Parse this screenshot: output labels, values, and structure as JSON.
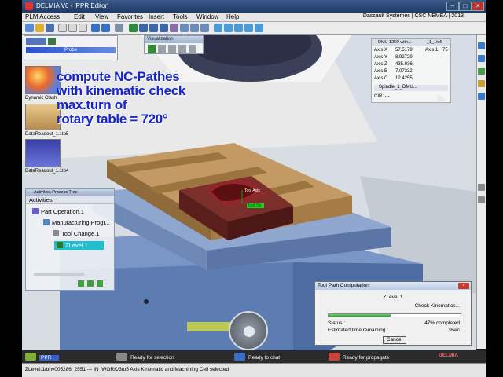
{
  "window": {
    "title": "DELMIA V6 - [PPR Editor]",
    "company": "Dassault Systemes | CSC NEMEA | 2013"
  },
  "menu": [
    "PLM Access",
    "Edit",
    "View",
    "Favorites",
    "Insert",
    "Tools",
    "Window",
    "Help"
  ],
  "overlay_text": [
    "compute NC-Pathes",
    "with kinematic check",
    "max.turn of",
    "rotary table = 720°"
  ],
  "panels": {
    "probe_label": "Probe",
    "visualization_title": "Visualization",
    "left_icons": [
      "Dynamic Clash",
      "DataReadout_1.1to5",
      "DataReadout_1.1to4"
    ]
  },
  "axis_panel": {
    "tab1": "DMU 125P with...",
    "tab2": "_1_1to5",
    "axes": [
      {
        "label": "Axis X",
        "value": "57.5179"
      },
      {
        "label": "Axis Y",
        "value": "8.92729"
      },
      {
        "label": "Axis Z",
        "value": "435.936"
      },
      {
        "label": "Axis B",
        "value": "7.07332"
      },
      {
        "label": "Axis C",
        "value": "12.4255"
      }
    ],
    "axis1_label": "Axis 1",
    "axis1_value": "75",
    "spindle": "Spindle_1_DMU...",
    "cir_label": "CIR: ---"
  },
  "scene_labels": {
    "tool_axis": "Tool Axis",
    "tool_tip": "Tool Tip"
  },
  "activities": {
    "title": "Activities Process Tree",
    "header": "Activities",
    "items": [
      "Part Operation.1",
      "Manufacturing Progr...",
      "Tool Change.1",
      "ZLevel.1"
    ]
  },
  "progress": {
    "title": "Tool Path Computation",
    "operation": "ZLevel.1",
    "phase": "Check Kinematics...",
    "status_label": "Status :",
    "status_value": "47% completed",
    "time_label": "Estimated time remaining :",
    "time_value": "9sec",
    "percent": 47,
    "cancel_label": "Cancel"
  },
  "taskbar": {
    "ppr_label": "PPR",
    "segments": [
      "Ready for selection",
      "Ready to chat",
      "Ready for propagate"
    ],
    "brand": "DELMIA"
  },
  "status": {
    "message": "ZLevel.1/bhv005286_2551 --- IN_WORK/3to5 Axis Kinematic and Machining Cell selected"
  },
  "colors": {
    "overlay_text": "#1726c8",
    "progress_fill": "#2ea02e",
    "selected_activity": "#1fbfcf",
    "wood": "#b48a57",
    "base_blue": "#7a96c6"
  }
}
